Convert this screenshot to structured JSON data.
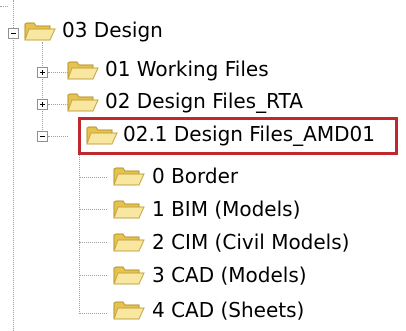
{
  "colors": {
    "highlight_border": "#c0282d",
    "folder_fill": "#f2d56b",
    "folder_front": "#f8e7a0",
    "connector": "#a0a0a0"
  },
  "tree": {
    "root": {
      "label": "03 Design",
      "icon": "folder-open-icon",
      "expander": "collapse"
    },
    "items": [
      {
        "label": "01 Working Files",
        "icon": "folder-icon",
        "expander": "expand"
      },
      {
        "label": "02 Design Files_RTA",
        "icon": "folder-icon",
        "expander": "expand"
      },
      {
        "label": "02.1 Design Files_AMD01",
        "icon": "folder-open-icon",
        "expander": "collapse",
        "highlighted": true
      }
    ],
    "children": [
      {
        "label": "0 Border",
        "icon": "folder-icon"
      },
      {
        "label": "1 BIM (Models)",
        "icon": "folder-icon"
      },
      {
        "label": "2 CIM (Civil Models)",
        "icon": "folder-icon"
      },
      {
        "label": "3 CAD (Models)",
        "icon": "folder-icon"
      },
      {
        "label": "4 CAD (Sheets)",
        "icon": "folder-icon"
      }
    ]
  }
}
